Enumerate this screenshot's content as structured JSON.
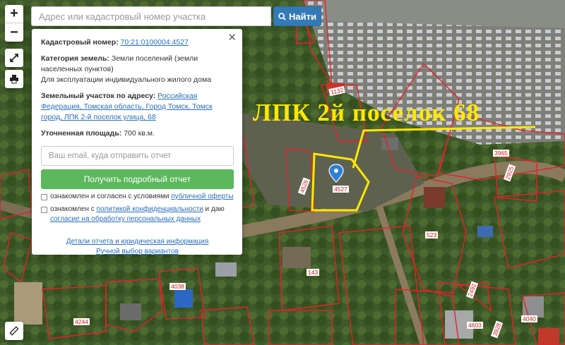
{
  "search": {
    "placeholder": "Адрес или кадастровый номер участка",
    "button_label": "Найти"
  },
  "controls": {
    "zoom_in": "+",
    "zoom_out": "−"
  },
  "info_panel": {
    "cadastral_label": "Кадастровый номер:",
    "cadastral_value": "70:21:0100004:4527",
    "category_label": "Категория земель:",
    "category_value": "Земли поселений (земли населенных пунктов)",
    "usage_value": "Для эксплуатации индивидуального жилого дома",
    "address_label": "Земельный участок по адресу:",
    "address_value": "Российская Федерация, Томская область, Город Томск, Томск город, ЛПК 2-й поселок улица, 68",
    "area_label": "Уточненная площадь:",
    "area_value": "700 кв.м.",
    "email_placeholder": "Ваш email, куда отправить отчет",
    "report_button": "Получить подробный отчет",
    "check1_text": "ознакомлен и согласен с условиями",
    "check1_link": "публичной оферты",
    "check2_text": "ознакомлен с",
    "check2_link1": "политикой конфиденциальности",
    "check2_mid": "и даю",
    "check2_link2": "согласие на обработку персональных данных",
    "details_link": "Детали отчета и юридическая информация",
    "manual_link": "Ручной выбор вариантов"
  },
  "map": {
    "caption": "ЛПК 2й поселок 68",
    "selected_parcel_label": "4527",
    "parcel_labels": [
      "1132",
      "3965",
      "2925",
      "4526",
      "523",
      "143",
      "4038",
      "4244",
      "4603",
      "3928",
      "4040",
      "2492"
    ],
    "colors": {
      "parcel_border": "#e8202a",
      "highlight": "#ffe800",
      "marker": "#2a7fd6"
    }
  }
}
